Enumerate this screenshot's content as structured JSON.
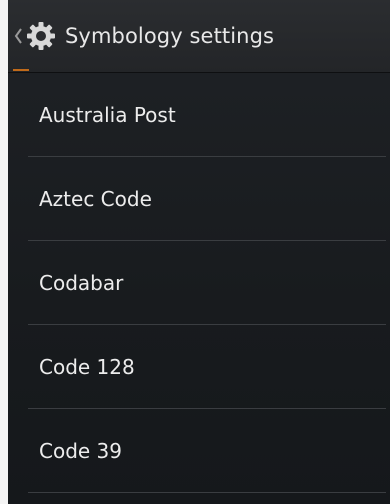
{
  "action_bar": {
    "title": "Symbology settings",
    "back_icon": "chevron-left-icon",
    "app_icon": "gear-icon",
    "accent_color": "#c06a1a"
  },
  "list": {
    "items": [
      {
        "label": "Australia Post"
      },
      {
        "label": "Aztec Code"
      },
      {
        "label": "Codabar"
      },
      {
        "label": "Code 128"
      },
      {
        "label": "Code 39"
      }
    ]
  },
  "colors": {
    "background": "#181b1e",
    "text": "#ececec",
    "divider": "#3a3d41"
  }
}
